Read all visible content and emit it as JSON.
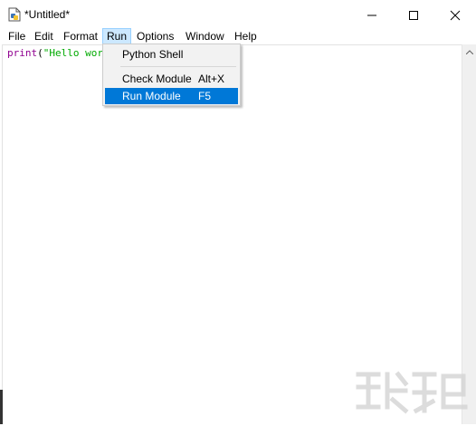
{
  "window": {
    "title": "*Untitled*",
    "controls": {
      "minimize_icon": "minimize-icon",
      "maximize_icon": "maximize-icon",
      "close_icon": "close-icon"
    }
  },
  "menubar": {
    "items": [
      {
        "label": "File"
      },
      {
        "label": "Edit"
      },
      {
        "label": "Format"
      },
      {
        "label": "Run",
        "active": true
      },
      {
        "label": "Options"
      },
      {
        "label": "Window"
      },
      {
        "label": "Help"
      }
    ]
  },
  "editor": {
    "code": {
      "builtin": "print",
      "paren": "(",
      "string": "\"Hello worl"
    }
  },
  "run_menu": {
    "items": [
      {
        "label": "Python Shell",
        "accelerator": ""
      },
      {
        "label": "Check Module",
        "accelerator": "Alt+X"
      },
      {
        "label": "Run Module",
        "accelerator": "F5",
        "highlighted": true
      }
    ]
  },
  "colors": {
    "highlight": "#0078d7",
    "menu_active": "#cce8ff",
    "code_builtin": "#900090",
    "code_string": "#00aa00"
  }
}
